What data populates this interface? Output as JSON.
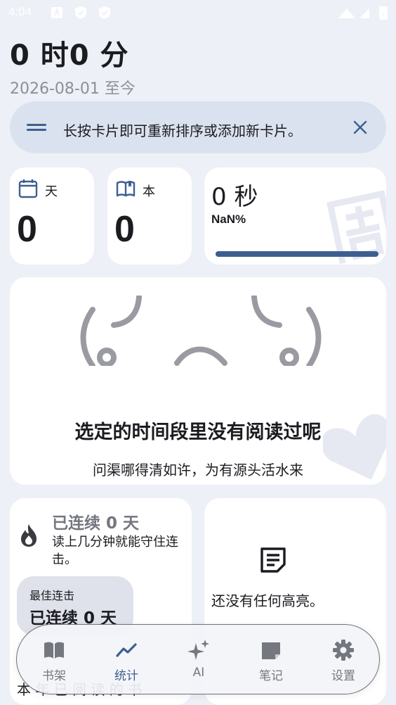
{
  "status_bar": {
    "time": "4:04"
  },
  "header": {
    "total_time": "0 时0 分",
    "date_range": "2026-08-01 至今"
  },
  "tip": {
    "text": "长按卡片即可重新排序或添加新卡片。"
  },
  "stats": {
    "days": {
      "label": "天",
      "value": "0"
    },
    "books": {
      "label": "本",
      "value": "0"
    },
    "time": {
      "value": "0 秒",
      "percent": "NaN%",
      "progress": 1.0
    }
  },
  "empty_state": {
    "kaomoji": "(｡╯︵╰｡)",
    "title": "选定的时间段里没有阅读过呢",
    "subtitle": "问渠哪得清如许，为有源头活水来"
  },
  "streak": {
    "title": "已连续 0 天",
    "description": "读上几分钟就能守住连击。",
    "best_label": "最佳连击",
    "best_value": "已连续 0 天",
    "footer": "本 年 已 阅 读 的 书"
  },
  "highlights": {
    "text": "还没有任何高亮。"
  },
  "nav": {
    "items": [
      {
        "label": "书架",
        "icon": "book-icon"
      },
      {
        "label": "统计",
        "icon": "chart-icon",
        "active": true
      },
      {
        "label": "AI",
        "icon": "sparkle-icon"
      },
      {
        "label": "笔记",
        "icon": "note-icon"
      },
      {
        "label": "设置",
        "icon": "gear-icon"
      }
    ]
  },
  "colors": {
    "accent": "#3d5f90",
    "background": "#eef0f7",
    "card": "#ffffff",
    "muted": "#75777f"
  }
}
